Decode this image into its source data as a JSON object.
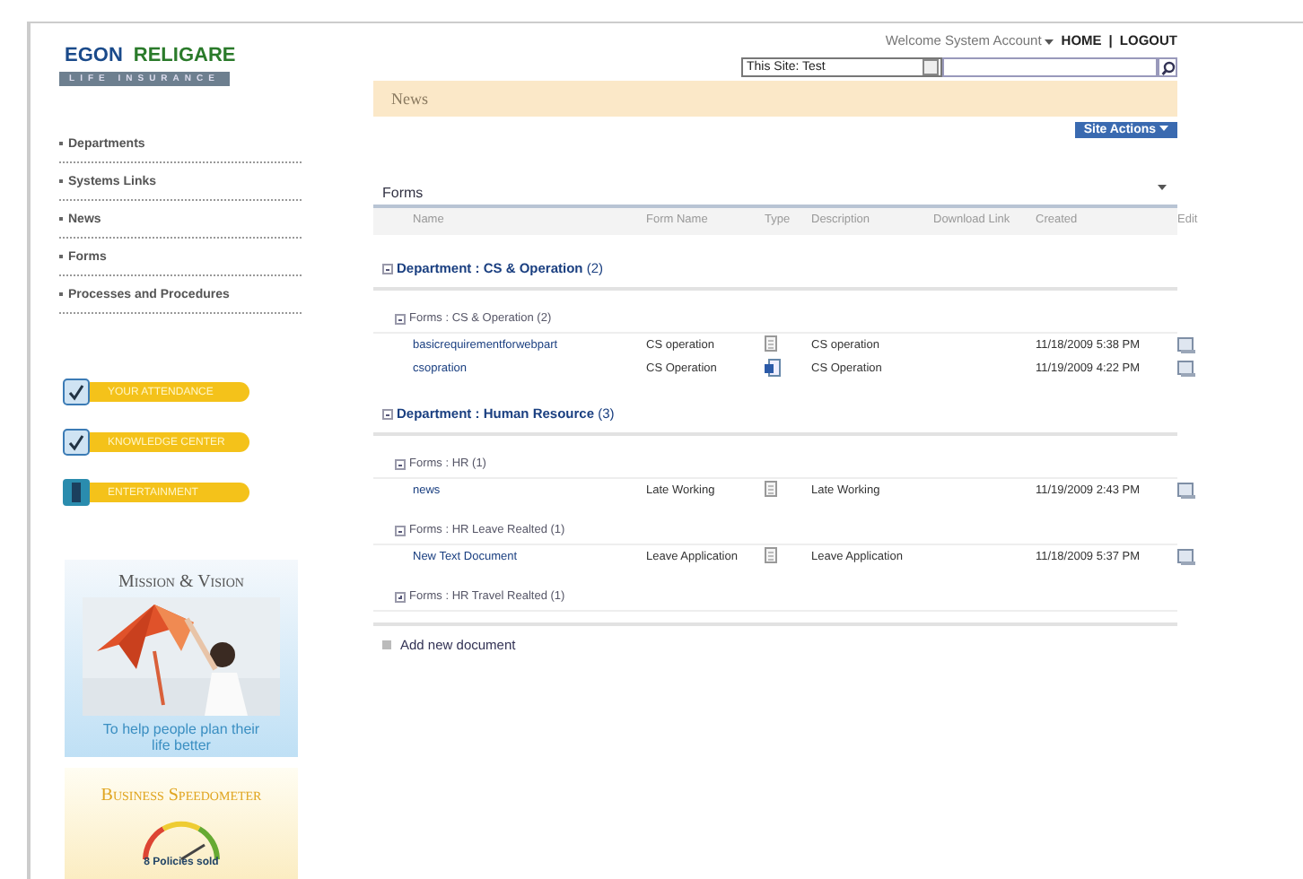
{
  "logo": {
    "brand_1": "EGON",
    "brand_2": "RELIGARE",
    "tagline": "LIFE INSURANCE"
  },
  "sidebar": {
    "items": [
      {
        "label": "Departments"
      },
      {
        "label": "Systems Links"
      },
      {
        "label": "News"
      },
      {
        "label": "Forms"
      },
      {
        "label": "Processes and Procedures"
      }
    ],
    "quick_links": [
      {
        "kind": "check",
        "label": "YOUR ATTENDANCE"
      },
      {
        "kind": "check",
        "label": "KNOWLEDGE CENTER"
      },
      {
        "kind": "film",
        "label": "ENTERTAINMENT"
      }
    ],
    "mission": {
      "title": "Mission & Vision",
      "caption": "To help people plan their life better"
    },
    "speedometer": {
      "title": "Business Speedometer",
      "reading": "8 Policies sold"
    }
  },
  "header": {
    "welcome": "Welcome System Account",
    "home_link": "HOME",
    "separator": "|",
    "logout_link": "LOGOUT"
  },
  "search": {
    "scope": "This Site: Test"
  },
  "page_title": "News",
  "site_actions": "Site Actions",
  "webpart": {
    "title": "Forms",
    "columns": [
      "Name",
      "Form Name",
      "Type",
      "Description",
      "Download Link",
      "Created",
      "Edit"
    ],
    "groups": [
      {
        "label": "**Department : CS & Operation** (2)",
        "expanded": true,
        "children": [
          {
            "label": "Forms : CS & Operation (2)",
            "expanded": true,
            "rows": [
              {
                "name": "basicrequirementforwebpart",
                "form_name": "CS operation",
                "kind": "text",
                "description": "CS operation",
                "created": "11/18/2009 5:38 PM"
              },
              {
                "name": "csopration",
                "form_name": "CS Operation",
                "kind": "word",
                "description": "CS Operation",
                "created": "11/19/2009 4:22 PM"
              }
            ]
          }
        ]
      },
      {
        "label": "**Department : Human Resource** (3)",
        "expanded": true,
        "children": [
          {
            "label": "Forms : HR (1)",
            "expanded": true,
            "rows": [
              {
                "name": "news",
                "form_name": "Late Working",
                "kind": "text",
                "description": "Late Working",
                "created": "11/19/2009 2:43 PM"
              }
            ]
          },
          {
            "label": "Forms : HR Leave Realted (1)",
            "expanded": true,
            "rows": [
              {
                "name": "New Text Document",
                "form_name": "Leave Application",
                "kind": "text",
                "description": "Leave Application",
                "created": "11/18/2009 5:37 PM"
              }
            ]
          },
          {
            "label": "Forms : HR Travel Realted (1)",
            "expanded": false
          }
        ]
      }
    ],
    "add_new": "Add new document"
  }
}
